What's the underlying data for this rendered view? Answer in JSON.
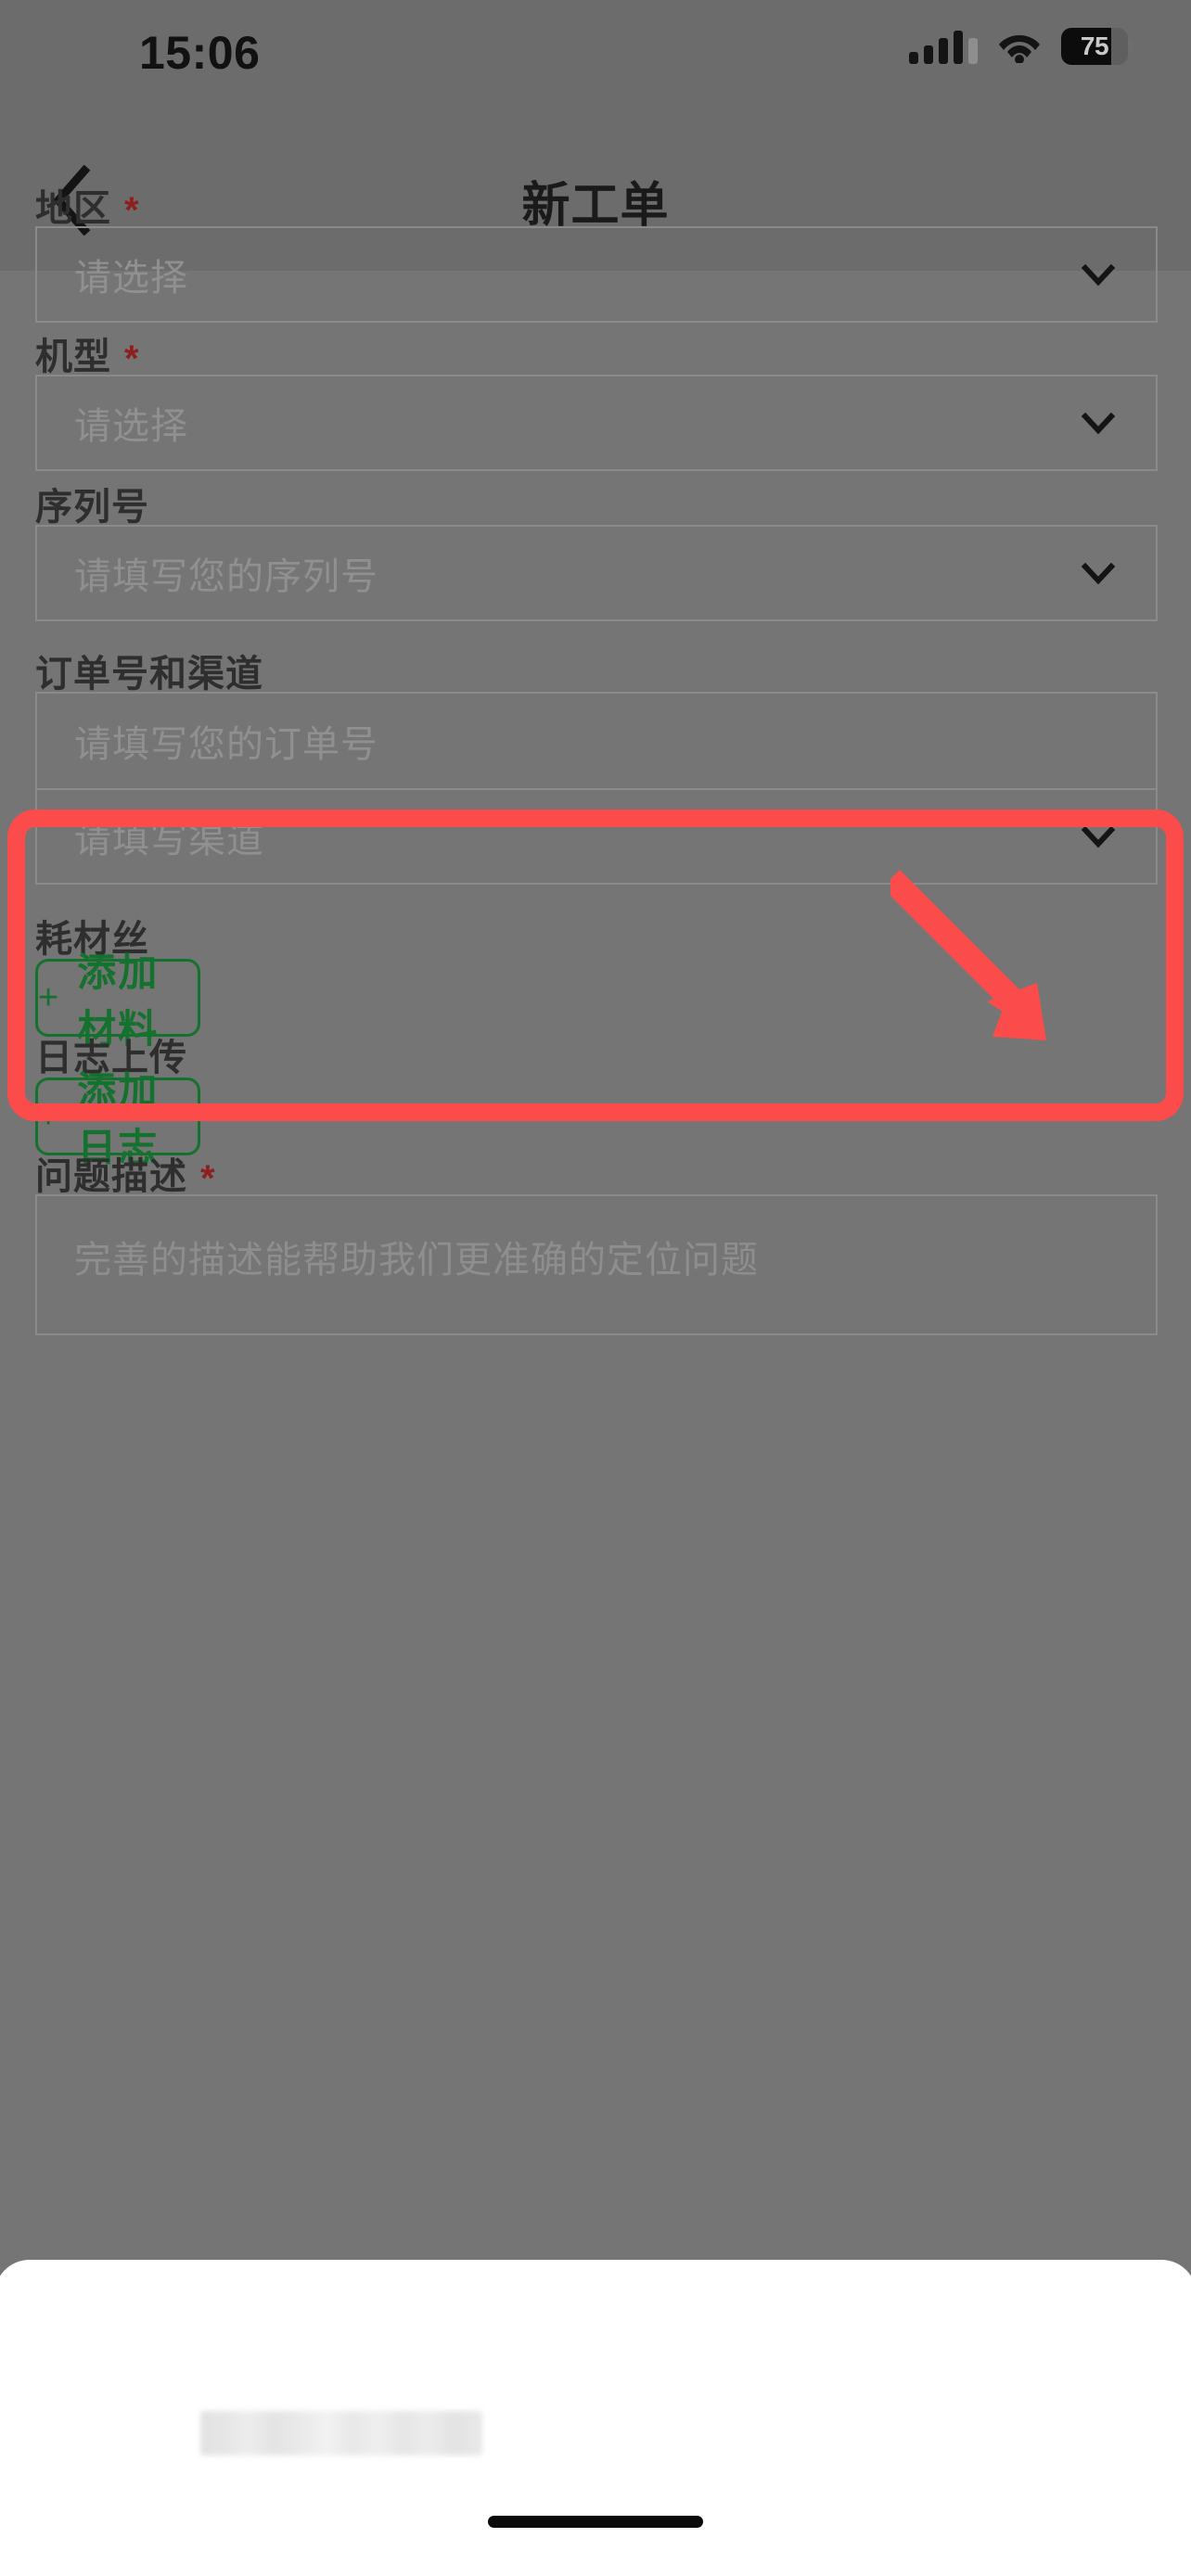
{
  "status_bar": {
    "time": "15:06",
    "battery_percent": "75",
    "signal_icon": "cellular-signal-icon",
    "wifi_icon": "wifi-icon",
    "battery_icon": "battery-icon"
  },
  "nav_bar": {
    "title": "新工单",
    "back_icon": "chevron-left-icon"
  },
  "form": {
    "region": {
      "label": "地区",
      "required_marker": "*",
      "placeholder": "请选择",
      "value": "",
      "chevron_icon": "chevron-down-icon"
    },
    "model": {
      "label": "机型",
      "required_marker": "*",
      "placeholder": "请选择",
      "value": "",
      "chevron_icon": "chevron-down-icon"
    },
    "serial_number": {
      "label": "序列号",
      "placeholder": "请填写您的序列号",
      "value": "",
      "chevron_icon": "chevron-down-icon"
    },
    "order_and_channel": {
      "label": "订单号和渠道",
      "order_placeholder": "请填写您的订单号",
      "order_value": "",
      "channel_placeholder": "请填写渠道",
      "channel_value": "",
      "chevron_icon": "chevron-down-icon"
    },
    "filament": {
      "label": "耗材丝",
      "add_button": {
        "plus": "+",
        "label": "添加材料"
      }
    },
    "log_upload": {
      "label": "日志上传",
      "add_button": {
        "plus": "+",
        "label": "添加日志"
      }
    },
    "problem_description": {
      "label": "问题描述",
      "required_marker": "*",
      "placeholder": "完善的描述能帮助我们更准确的定位问题",
      "value": ""
    }
  },
  "annotation": {
    "highlight_color": "#FB4B4B",
    "arrow_icon": "red-arrow-pointing-down-right",
    "target": "serial-number-chevron"
  },
  "bottom_sheet": {
    "redacted_content": "",
    "home_indicator": "home-indicator"
  },
  "colors": {
    "page_background": "#757575",
    "nav_background": "#6C6C6C",
    "accent_green": "#15712E",
    "required_red": "#8C1F1F",
    "annotation_red": "#FB4B4B",
    "sheet_white": "#FFFFFF"
  }
}
